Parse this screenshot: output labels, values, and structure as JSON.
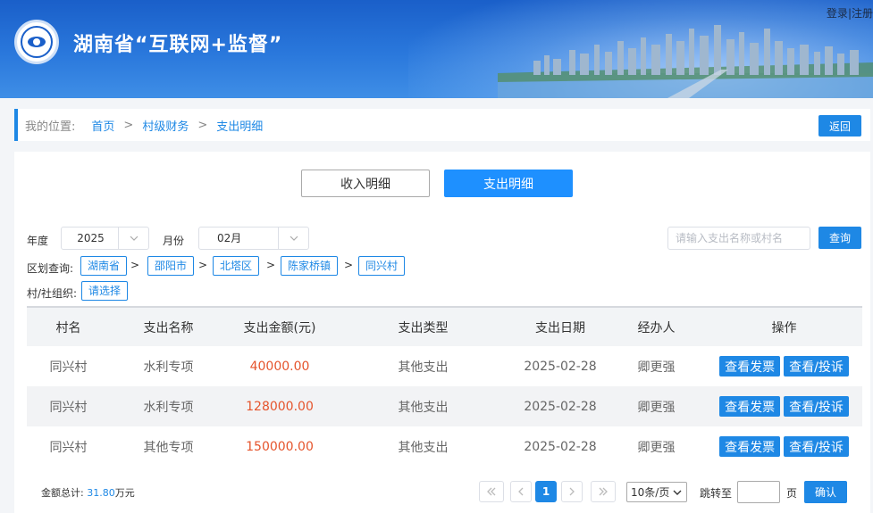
{
  "header": {
    "site_title": "湖南省“互联网+监督”",
    "login": "登录",
    "divider": "|",
    "register": "注册"
  },
  "breadcrumb": {
    "label": "我的位置:",
    "items": [
      "首页",
      "村级财务",
      "支出明细"
    ],
    "separator": ">",
    "back_label": "返回"
  },
  "tabs": {
    "income": "收入明细",
    "expense": "支出明细"
  },
  "filters": {
    "year_label": "年度",
    "year_value": "2025",
    "month_label": "月份",
    "month_value": "02月",
    "search_placeholder": "请输入支出名称或村名",
    "search_button": "查询",
    "region_label": "区划查询:",
    "regions": [
      "湖南省",
      "邵阳市",
      "北塔区",
      "陈家桥镇",
      "同兴村"
    ],
    "region_separator": ">",
    "org_label": "村/社组织:",
    "org_button": "请选择"
  },
  "table": {
    "headers": [
      "村名",
      "支出名称",
      "支出金额(元)",
      "支出类型",
      "支出日期",
      "经办人",
      "操作"
    ],
    "rows": [
      {
        "village": "同兴村",
        "name": "水利专项",
        "amount": "40000.00",
        "type": "其他支出",
        "date": "2025-02-28",
        "handler": "卿更强"
      },
      {
        "village": "同兴村",
        "name": "水利专项",
        "amount": "128000.00",
        "type": "其他支出",
        "date": "2025-02-28",
        "handler": "卿更强"
      },
      {
        "village": "同兴村",
        "name": "其他专项",
        "amount": "150000.00",
        "type": "其他支出",
        "date": "2025-02-28",
        "handler": "卿更强"
      }
    ],
    "view_invoice": "查看发票",
    "view_complaint": "查看/投诉"
  },
  "footer": {
    "total_label": "金额总计:",
    "total_value": "31.80",
    "total_unit": "万元",
    "current_page": "1",
    "page_size": "10条/页",
    "jump_label": "跳转至",
    "page_unit": "页",
    "confirm": "确认"
  },
  "colors": {
    "accent": "#1e88e5",
    "amount": "#e5542c"
  }
}
